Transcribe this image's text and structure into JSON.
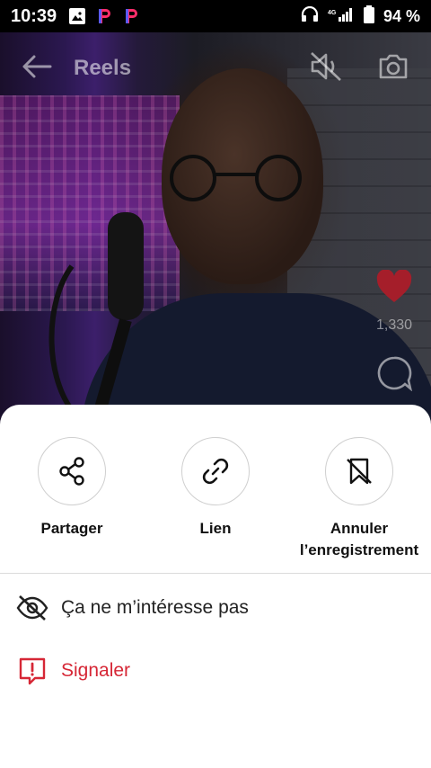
{
  "status_bar": {
    "time": "10:39",
    "battery": "94 %"
  },
  "header": {
    "title": "Reels"
  },
  "side": {
    "like_count": "1,330"
  },
  "sheet": {
    "actions": [
      {
        "label": "Partager",
        "icon": "share-icon"
      },
      {
        "label": "Lien",
        "icon": "link-icon"
      },
      {
        "label": "Annuler l’enregistrement",
        "icon": "unsave-icon"
      }
    ],
    "menu": [
      {
        "label": "Ça ne m’intéresse pas",
        "icon": "eye-off-icon"
      },
      {
        "label": "Signaler",
        "icon": "report-icon"
      }
    ]
  },
  "colors": {
    "danger": "#d62736",
    "like": "#c2212f",
    "sheet_bg": "#ffffff"
  }
}
